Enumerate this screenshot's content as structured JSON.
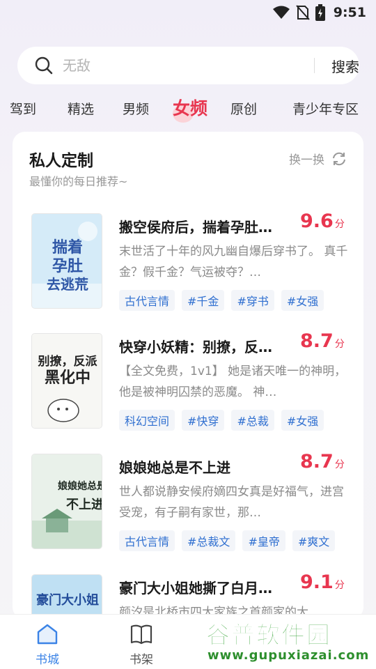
{
  "status_bar": {
    "time": "9:51"
  },
  "search": {
    "placeholder": "无敌",
    "button_label": "搜索"
  },
  "tabs": [
    "驾到",
    "精选",
    "男频",
    "女频",
    "原创",
    "青少年专区"
  ],
  "active_tab_index": 3,
  "section": {
    "title": "私人定制",
    "subtitle": "最懂你的每日推荐~",
    "refresh_label": "换一换"
  },
  "books": [
    {
      "title": "搬空侯府后，揣着孕肚…",
      "score": "9.6",
      "score_unit": "分",
      "desc": "末世活了十年的风九幽自爆后穿书了。 真千金？假千金？气运被夺？…",
      "tags": [
        "古代言情",
        "#千金",
        "#穿书",
        "#女强"
      ],
      "cover_text": [
        "揣着",
        "孕肚",
        "去逃荒"
      ],
      "cover_colors": [
        "#cfe6f6",
        "#2e56a6"
      ]
    },
    {
      "title": "快穿小妖精：别撩，反…",
      "score": "8.7",
      "score_unit": "分",
      "desc": "【全文免费，1v1】 她是诸天唯一的神明，他是被神明囚禁的恶魔。 神…",
      "tags": [
        "科幻空间",
        "#快穿",
        "#总裁",
        "#女强"
      ],
      "cover_text": [
        "别撩，反派",
        "黑化中"
      ],
      "cover_colors": [
        "#f7f7f4",
        "#222222"
      ]
    },
    {
      "title": "娘娘她总是不上进",
      "score": "8.7",
      "score_unit": "分",
      "desc": "世人都说静安候府嫡四女真是好福气，进宫受宠，有子嗣有家世，那…",
      "tags": [
        "古代言情",
        "#总裁文",
        "#皇帝",
        "#爽文"
      ],
      "cover_text": [
        "娘娘她总是",
        "不上进"
      ],
      "cover_colors": [
        "#e9f1ea",
        "#1f2a22"
      ]
    },
    {
      "title": "豪门大小姐她撕了白月…",
      "score": "9.1",
      "score_unit": "分",
      "desc": "颜汐是北桥市四大家族之首颜家的大…",
      "tags": [],
      "cover_text": [
        "豪门大小姐"
      ],
      "cover_colors": [
        "#bfe0f3",
        "#234d9a"
      ]
    }
  ],
  "bottom_nav": [
    {
      "label": "书城",
      "icon": "home-icon",
      "active": true
    },
    {
      "label": "书架",
      "icon": "bookshelf-icon",
      "active": false
    }
  ],
  "watermark": {
    "text": "谷普软件园",
    "url": "www.gupuxiazai.com"
  },
  "colors": {
    "accent": "#e8364f",
    "link": "#2f6fd0",
    "nav_active": "#3b83e6"
  }
}
